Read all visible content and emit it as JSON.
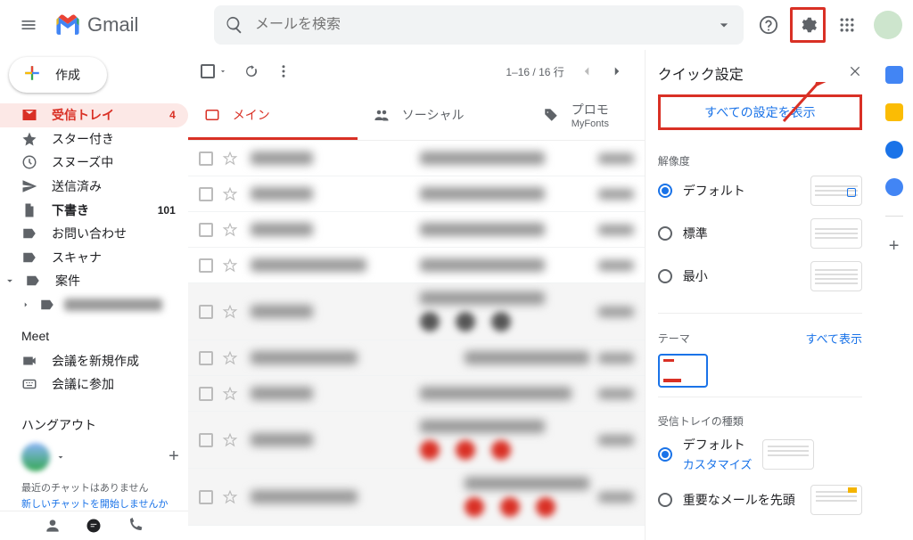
{
  "header": {
    "app_name": "Gmail",
    "search_placeholder": "メールを検索"
  },
  "compose_label": "作成",
  "sidebar": [
    {
      "label": "受信トレイ",
      "count": "4"
    },
    {
      "label": "スター付き"
    },
    {
      "label": "スヌーズ中"
    },
    {
      "label": "送信済み"
    },
    {
      "label": "下書き",
      "count": "101"
    },
    {
      "label": "お問い合わせ"
    },
    {
      "label": "スキャナ"
    },
    {
      "label": "案件"
    }
  ],
  "meet": {
    "title": "Meet",
    "new": "会議を新規作成",
    "join": "会議に参加"
  },
  "hangout": {
    "title": "ハングアウト",
    "no_recent": "最近のチャットはありません",
    "start_new": "新しいチャットを開始しませんか"
  },
  "toolbar": {
    "range": "1–16 / 16 行"
  },
  "tabs": {
    "main": "メイン",
    "social": "ソーシャル",
    "promo": "プロモ",
    "promo_sub": "MyFonts"
  },
  "quick": {
    "title": "クイック設定",
    "all_settings": "すべての設定を表示",
    "density_title": "解像度",
    "density": [
      "デフォルト",
      "標準",
      "最小"
    ],
    "theme_title": "テーマ",
    "theme_all": "すべて表示",
    "inbox_type_title": "受信トレイの種類",
    "inbox_default": "デフォルト",
    "inbox_customize": "カスタマイズ",
    "inbox_important": "重要なメールを先頭"
  }
}
